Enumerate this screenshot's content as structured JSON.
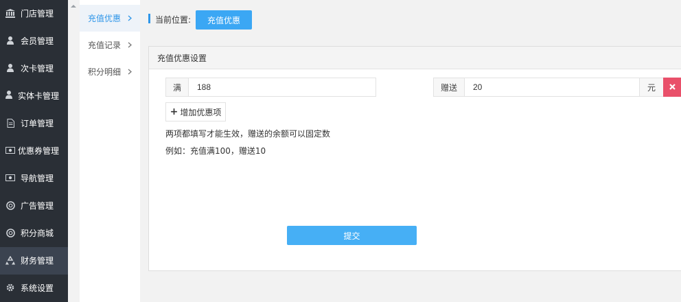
{
  "sidebar": {
    "items": [
      {
        "label": "门店管理",
        "icon": "bank-icon"
      },
      {
        "label": "会员管理",
        "icon": "user-icon"
      },
      {
        "label": "次卡管理",
        "icon": "user-icon"
      },
      {
        "label": "实体卡管理",
        "icon": "user-icon"
      },
      {
        "label": "订单管理",
        "icon": "document-icon"
      },
      {
        "label": "优惠券管理",
        "icon": "ticket-icon"
      },
      {
        "label": "导航管理",
        "icon": "ticket-icon"
      },
      {
        "label": "广告管理",
        "icon": "lifebuoy-icon"
      },
      {
        "label": "积分商城",
        "icon": "lifebuoy-icon"
      },
      {
        "label": "财务管理",
        "icon": "recycle-icon"
      },
      {
        "label": "系统设置",
        "icon": "gear-icon"
      }
    ],
    "active_index": 9
  },
  "subnav": {
    "items": [
      {
        "label": "充值优惠"
      },
      {
        "label": "充值记录"
      },
      {
        "label": "积分明细"
      }
    ],
    "active_index": 0
  },
  "breadcrumb": {
    "label": "当前位置:",
    "current": "充值优惠"
  },
  "panel": {
    "title": "充值优惠设置",
    "rule": {
      "full_label": "满",
      "full_value": "188",
      "gift_label": "赠送",
      "gift_value": "20",
      "unit": "元"
    },
    "add_button": "增加优惠项",
    "hint_1": "两项都填写才能生效，赠送的余额可以固定数",
    "hint_2": "例如：充值满100，赠送10",
    "submit": "提交"
  },
  "colors": {
    "sidebar_bg": "#2a2f36",
    "accent": "#3ba7f4",
    "danger": "#e9506a"
  }
}
